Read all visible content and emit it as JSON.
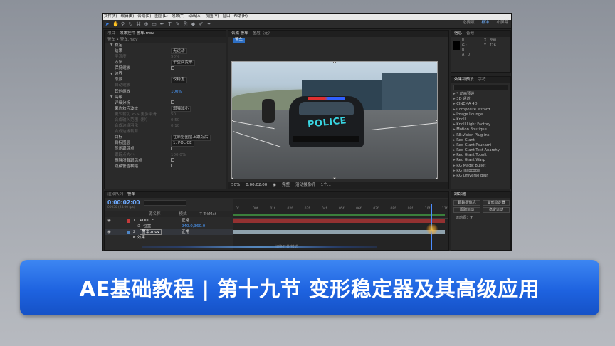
{
  "menu": [
    "文件(F)",
    "编辑(E)",
    "合成(C)",
    "图层(L)",
    "效果(T)",
    "动画(A)",
    "视图(V)",
    "窗口",
    "帮助(H)"
  ],
  "workspace_tabs": [
    "必要项",
    "标准",
    "小屏幕"
  ],
  "workspace_active": "标准",
  "left_panel": {
    "tab_project": "项目",
    "tab_effects": "效果控件 警车.mov",
    "breadcrumb": "警车 • 警车.mov",
    "rows": [
      {
        "label": "稳定",
        "value": "",
        "kind": "section"
      },
      {
        "label": "结果",
        "value": "无运动",
        "kind": "select"
      },
      {
        "label": "平滑度",
        "value": "50%",
        "kind": "dim"
      },
      {
        "label": "方法",
        "value": "子空间变形",
        "kind": "select"
      },
      {
        "label": "保持缩放",
        "value": "",
        "kind": "check"
      },
      {
        "label": "边界",
        "value": "",
        "kind": "section"
      },
      {
        "label": "取景",
        "value": "仅稳定",
        "kind": "select"
      },
      {
        "label": "自动缩放",
        "value": "",
        "kind": "dim"
      },
      {
        "label": "其他缩放",
        "value": "100%",
        "kind": "blue"
      },
      {
        "label": "高级",
        "value": "",
        "kind": "section"
      },
      {
        "label": "详细分析",
        "value": "",
        "kind": "check"
      },
      {
        "label": "果冻效应波纹",
        "value": "增强减小",
        "kind": "select"
      },
      {
        "label": "更少裁切 <-> 更多平滑",
        "value": "50",
        "kind": "dim"
      },
      {
        "label": "合成输入范围（秒）",
        "value": "0.50",
        "kind": "dim"
      },
      {
        "label": "合成边缘羽化",
        "value": "0.10",
        "kind": "dim"
      },
      {
        "label": "合成边缘裁剪",
        "value": "",
        "kind": "dim"
      },
      {
        "label": "目标",
        "value": "在原始图层上跟踪后",
        "kind": "select"
      },
      {
        "label": "目标图层",
        "value": "1. POLICE",
        "kind": "select"
      },
      {
        "label": "显示跟踪点",
        "value": "",
        "kind": "check"
      },
      {
        "label": "跟踪点大小",
        "value": "100.0%",
        "kind": "dim"
      },
      {
        "label": "删除所有跟踪点",
        "value": "",
        "kind": "check"
      },
      {
        "label": "隐藏警告横幅",
        "value": "",
        "kind": "check"
      }
    ]
  },
  "comp_panel": {
    "tab_comp": "合成 警车",
    "tab_layer": "图层（无）",
    "comp_name_tag": "警车",
    "zoom": "50%",
    "timecode": "0:00:02:00",
    "quality": "完整",
    "camera": "活动摄像机",
    "views": "1个..."
  },
  "right_panel": {
    "tab_info": "信息",
    "tab_audio": "音频",
    "info_r": "R :",
    "info_g": "G :",
    "info_b": "B :",
    "info_a": "A : 0",
    "info_x": "X : 890",
    "info_y": "Y : 726",
    "effects_tab": "效果和预设",
    "char_tab": "字符",
    "effects_list": [
      "* 动画预设",
      "3D 通道",
      "CINEMA 4D",
      "Composite Wizard",
      "Image Lounge",
      "Knoll",
      "Knoll Light Factory",
      "Motion Boutique",
      "RE:Vision Plug-ins",
      "Red Giant",
      "Red Giant Psunami",
      "Red Giant Text Anarchy",
      "Red Giant ToonIt",
      "Red Giant Warp",
      "RG Magic Bullet",
      "RG Trapcode",
      "RG Universe Blur"
    ],
    "tracker_tab": "跟踪器",
    "tracker_btn1": "跟踪摄像机",
    "tracker_btn2": "变形稳定器",
    "tracker_btn3": "跟踪运动",
    "tracker_btn4": "稳定运动",
    "tracker_source": "运动源：无"
  },
  "timeline": {
    "tab_render": "渲染队列",
    "tab_comp": "警车",
    "timecode": "0:00:02:00",
    "frame_info": "00050 (25.00 fps)",
    "col_name": "源名称",
    "col_mode": "模式",
    "col_trkmat": "T TrkMat",
    "layers": [
      {
        "num": "1",
        "name": "POLICE",
        "mode": "正常"
      },
      {
        "num": "",
        "name": "位置",
        "mode": "940.0,360.0"
      },
      {
        "num": "2",
        "name": "警车.mov",
        "mode": "正常"
      },
      {
        "num": "",
        "name": "效果",
        "mode": ""
      }
    ],
    "ruler": [
      "0f",
      "00f",
      "01f",
      "02f",
      "03f",
      "04f",
      "05f",
      "06f",
      "07f",
      "08f",
      "09f",
      "10f",
      "11f"
    ],
    "footer": "切换开关/模式"
  },
  "banner": {
    "title": "AE基础教程 | 第十九节 变形稳定器及其高级应用"
  },
  "colors": {
    "banner": "#1e63e0",
    "accent": "#3e8bff",
    "police_text": "#39d5e2"
  }
}
